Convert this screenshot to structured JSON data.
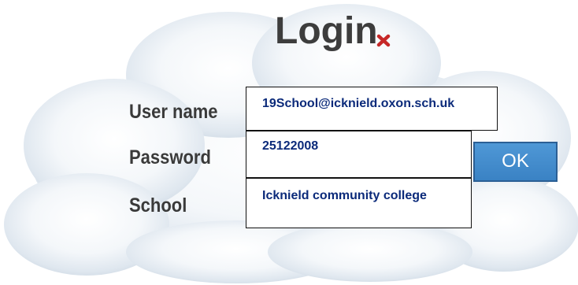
{
  "dialog": {
    "title": "Login"
  },
  "form": {
    "username_label": "User name",
    "username_value": "19School@icknield.oxon.sch.uk",
    "password_label": "Password",
    "password_value": "25122008",
    "school_label": "School",
    "school_value": "Icknield community college",
    "ok_label": "OK"
  },
  "icons": {
    "close": "close-icon"
  },
  "colors": {
    "title": "#3d3d3d",
    "field_text": "#0b2a7a",
    "ok_button": "#4a90d0",
    "close_icon": "#c62828"
  }
}
